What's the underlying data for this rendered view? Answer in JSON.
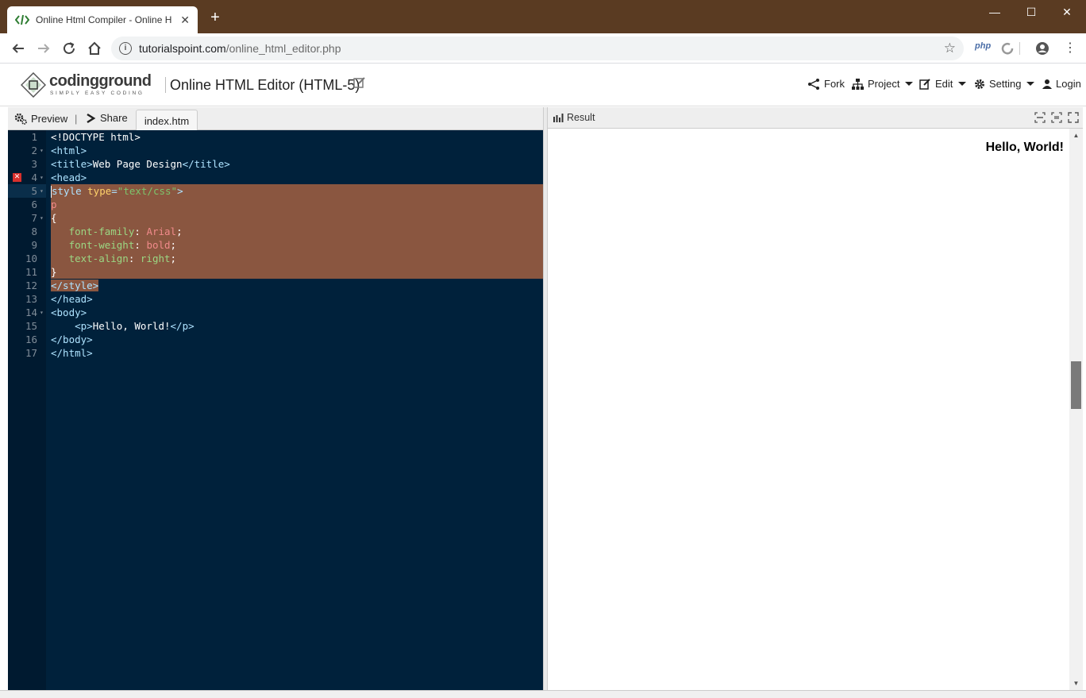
{
  "browser": {
    "tab_title": "Online Html Compiler - Online H",
    "tab_close": "✕",
    "new_tab": "+",
    "url_host": "tutorialspoint.com",
    "url_path": "/online_html_editor.php",
    "ext_php": "php",
    "window": {
      "minimize": "—",
      "maximize": "☐",
      "close": "✕"
    }
  },
  "header": {
    "brand": "codingground",
    "tagline": "SIMPLY EASY CODING",
    "title": "Online HTML Editor (HTML-5)",
    "menu": {
      "fork": "Fork",
      "project": "Project",
      "edit": "Edit",
      "setting": "Setting",
      "login": "Login"
    }
  },
  "editor": {
    "preview_label": "Preview",
    "share_label": "Share",
    "file_tab": "index.htm",
    "line_numbers": [
      "1",
      "2",
      "3",
      "4",
      "5",
      "6",
      "7",
      "8",
      "9",
      "10",
      "11",
      "12",
      "13",
      "14",
      "15",
      "16",
      "17"
    ]
  },
  "result": {
    "label": "Result",
    "output_text": "Hello, World!"
  },
  "colors": {
    "titlebar": "#5a3b22",
    "editor_bg": "#00213b",
    "selection": "#8a5640"
  }
}
